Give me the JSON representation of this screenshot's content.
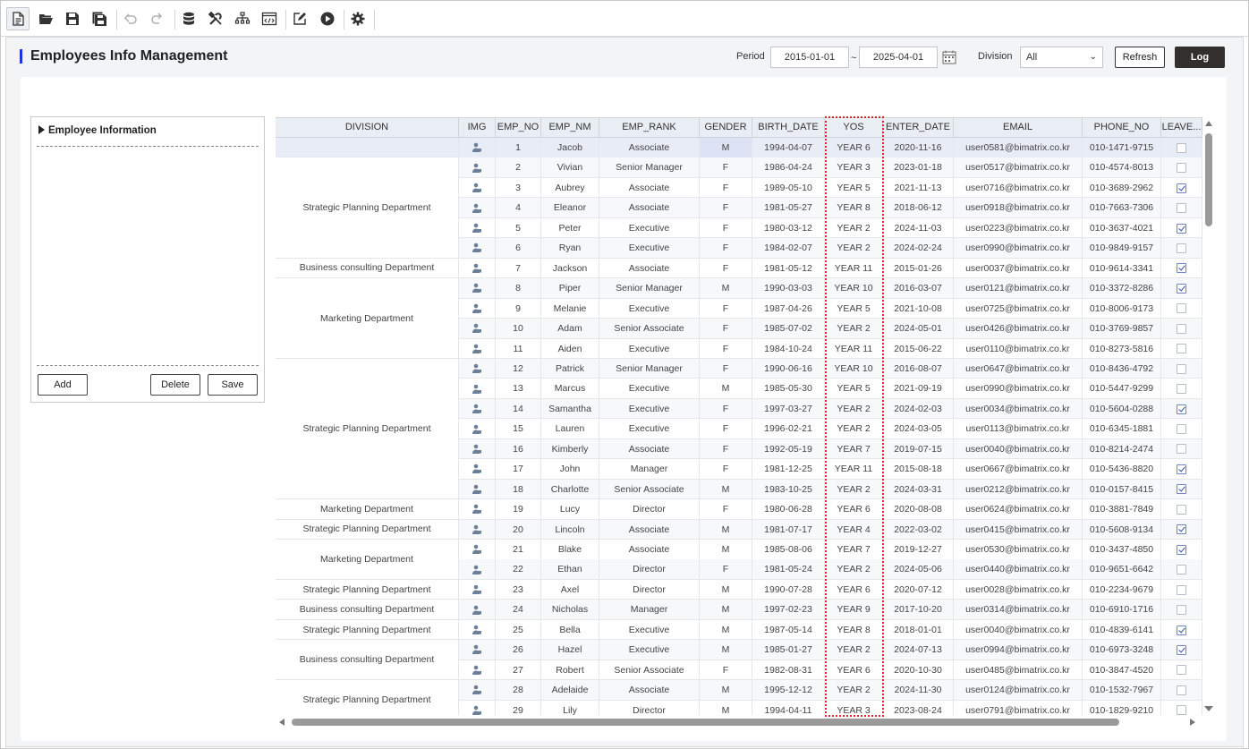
{
  "toolbar": {
    "icons": [
      "new-document-icon",
      "open-folder-icon",
      "save-icon",
      "save-all-icon",
      "undo-icon",
      "redo-icon",
      "database-icon",
      "tools-icon",
      "hierarchy-icon",
      "code-window-icon",
      "edit-icon",
      "run-icon",
      "settings-icon"
    ]
  },
  "header": {
    "title": "Employees Info Management",
    "period_label": "Period",
    "period_from": "2015-01-01",
    "period_sep": "~",
    "period_to": "2025-04-01",
    "division_label": "Division",
    "division_value": "All",
    "refresh_label": "Refresh",
    "log_label": "Log"
  },
  "left_panel": {
    "title": "Employee Information",
    "add_label": "Add",
    "delete_label": "Delete",
    "save_label": "Save"
  },
  "grid": {
    "columns": [
      "DIVISION",
      "IMG",
      "EMP_NO",
      "EMP_NM",
      "EMP_RANK",
      "GENDER",
      "BIRTH_DATE",
      "YOS",
      "ENTER_DATE",
      "EMAIL",
      "PHONE_NO",
      "LEAVE..."
    ],
    "division_groups": [
      {
        "label": "",
        "rows": 1
      },
      {
        "label": "Strategic Planning Department",
        "rows": 5
      },
      {
        "label": "Business consulting Department",
        "rows": 1
      },
      {
        "label": "Marketing Department",
        "rows": 4
      },
      {
        "label": "Strategic Planning Department",
        "rows": 7
      },
      {
        "label": "Marketing Department",
        "rows": 1
      },
      {
        "label": "Strategic Planning Department",
        "rows": 1
      },
      {
        "label": "Marketing Department",
        "rows": 2
      },
      {
        "label": "Strategic Planning Department",
        "rows": 1
      },
      {
        "label": "Business consulting Department",
        "rows": 1
      },
      {
        "label": "Strategic Planning Department",
        "rows": 1
      },
      {
        "label": "Business consulting Department",
        "rows": 2
      },
      {
        "label": "Strategic Planning Department",
        "rows": 2
      }
    ],
    "rows": [
      {
        "no": "1",
        "nm": "Jacob",
        "rank": "Associate",
        "g": "M",
        "bd": "1994-04-07",
        "yos": "YEAR 6",
        "ed": "2020-11-16",
        "email": "user0581@bimatrix.co.kr",
        "phone": "010-1471-9715",
        "leave": false
      },
      {
        "no": "2",
        "nm": "Vivian",
        "rank": "Senior Manager",
        "g": "F",
        "bd": "1986-04-24",
        "yos": "YEAR 3",
        "ed": "2023-01-18",
        "email": "user0517@bimatrix.co.kr",
        "phone": "010-4574-8013",
        "leave": false
      },
      {
        "no": "3",
        "nm": "Aubrey",
        "rank": "Associate",
        "g": "F",
        "bd": "1989-05-10",
        "yos": "YEAR 5",
        "ed": "2021-11-13",
        "email": "user0716@bimatrix.co.kr",
        "phone": "010-3689-2962",
        "leave": true
      },
      {
        "no": "4",
        "nm": "Eleanor",
        "rank": "Associate",
        "g": "F",
        "bd": "1981-05-27",
        "yos": "YEAR 8",
        "ed": "2018-06-12",
        "email": "user0918@bimatrix.co.kr",
        "phone": "010-7663-7306",
        "leave": false
      },
      {
        "no": "5",
        "nm": "Peter",
        "rank": "Executive",
        "g": "F",
        "bd": "1980-03-12",
        "yos": "YEAR 2",
        "ed": "2024-11-03",
        "email": "user0223@bimatrix.co.kr",
        "phone": "010-3637-4021",
        "leave": true
      },
      {
        "no": "6",
        "nm": "Ryan",
        "rank": "Executive",
        "g": "F",
        "bd": "1984-02-07",
        "yos": "YEAR 2",
        "ed": "2024-02-24",
        "email": "user0990@bimatrix.co.kr",
        "phone": "010-9849-9157",
        "leave": false
      },
      {
        "no": "7",
        "nm": "Jackson",
        "rank": "Associate",
        "g": "F",
        "bd": "1981-05-12",
        "yos": "YEAR 11",
        "ed": "2015-01-26",
        "email": "user0037@bimatrix.co.kr",
        "phone": "010-9614-3341",
        "leave": true
      },
      {
        "no": "8",
        "nm": "Piper",
        "rank": "Senior Manager",
        "g": "M",
        "bd": "1990-03-03",
        "yos": "YEAR 10",
        "ed": "2016-03-07",
        "email": "user0121@bimatrix.co.kr",
        "phone": "010-3372-8286",
        "leave": true
      },
      {
        "no": "9",
        "nm": "Melanie",
        "rank": "Executive",
        "g": "F",
        "bd": "1987-04-26",
        "yos": "YEAR 5",
        "ed": "2021-10-08",
        "email": "user0725@bimatrix.co.kr",
        "phone": "010-8006-9173",
        "leave": false
      },
      {
        "no": "10",
        "nm": "Adam",
        "rank": "Senior Associate",
        "g": "F",
        "bd": "1985-07-02",
        "yos": "YEAR 2",
        "ed": "2024-05-01",
        "email": "user0426@bimatrix.co.kr",
        "phone": "010-3769-9857",
        "leave": false
      },
      {
        "no": "11",
        "nm": "Aiden",
        "rank": "Executive",
        "g": "F",
        "bd": "1984-10-24",
        "yos": "YEAR 11",
        "ed": "2015-06-22",
        "email": "user0110@bimatrix.co.kr",
        "phone": "010-8273-5816",
        "leave": false
      },
      {
        "no": "12",
        "nm": "Patrick",
        "rank": "Senior Manager",
        "g": "F",
        "bd": "1990-06-16",
        "yos": "YEAR 10",
        "ed": "2016-08-07",
        "email": "user0647@bimatrix.co.kr",
        "phone": "010-8436-4792",
        "leave": false
      },
      {
        "no": "13",
        "nm": "Marcus",
        "rank": "Executive",
        "g": "M",
        "bd": "1985-05-30",
        "yos": "YEAR 5",
        "ed": "2021-09-19",
        "email": "user0990@bimatrix.co.kr",
        "phone": "010-5447-9299",
        "leave": false
      },
      {
        "no": "14",
        "nm": "Samantha",
        "rank": "Executive",
        "g": "F",
        "bd": "1997-03-27",
        "yos": "YEAR 2",
        "ed": "2024-02-03",
        "email": "user0034@bimatrix.co.kr",
        "phone": "010-5604-0288",
        "leave": true
      },
      {
        "no": "15",
        "nm": "Lauren",
        "rank": "Executive",
        "g": "F",
        "bd": "1996-02-21",
        "yos": "YEAR 2",
        "ed": "2024-03-05",
        "email": "user0113@bimatrix.co.kr",
        "phone": "010-6345-1881",
        "leave": false
      },
      {
        "no": "16",
        "nm": "Kimberly",
        "rank": "Associate",
        "g": "F",
        "bd": "1992-05-19",
        "yos": "YEAR 7",
        "ed": "2019-07-15",
        "email": "user0040@bimatrix.co.kr",
        "phone": "010-8214-2474",
        "leave": false
      },
      {
        "no": "17",
        "nm": "John",
        "rank": "Manager",
        "g": "F",
        "bd": "1981-12-25",
        "yos": "YEAR 11",
        "ed": "2015-08-18",
        "email": "user0667@bimatrix.co.kr",
        "phone": "010-5436-8820",
        "leave": true
      },
      {
        "no": "18",
        "nm": "Charlotte",
        "rank": "Senior Associate",
        "g": "M",
        "bd": "1983-10-25",
        "yos": "YEAR 2",
        "ed": "2024-03-31",
        "email": "user0212@bimatrix.co.kr",
        "phone": "010-0157-8415",
        "leave": true
      },
      {
        "no": "19",
        "nm": "Lucy",
        "rank": "Director",
        "g": "F",
        "bd": "1980-06-28",
        "yos": "YEAR 6",
        "ed": "2020-08-08",
        "email": "user0624@bimatrix.co.kr",
        "phone": "010-3881-7849",
        "leave": false
      },
      {
        "no": "20",
        "nm": "Lincoln",
        "rank": "Associate",
        "g": "M",
        "bd": "1981-07-17",
        "yos": "YEAR 4",
        "ed": "2022-03-02",
        "email": "user0415@bimatrix.co.kr",
        "phone": "010-5608-9134",
        "leave": true
      },
      {
        "no": "21",
        "nm": "Blake",
        "rank": "Associate",
        "g": "M",
        "bd": "1985-08-06",
        "yos": "YEAR 7",
        "ed": "2019-12-27",
        "email": "user0530@bimatrix.co.kr",
        "phone": "010-3437-4850",
        "leave": true
      },
      {
        "no": "22",
        "nm": "Ethan",
        "rank": "Director",
        "g": "F",
        "bd": "1981-05-24",
        "yos": "YEAR 2",
        "ed": "2024-05-06",
        "email": "user0440@bimatrix.co.kr",
        "phone": "010-9651-6642",
        "leave": false
      },
      {
        "no": "23",
        "nm": "Axel",
        "rank": "Director",
        "g": "M",
        "bd": "1990-07-28",
        "yos": "YEAR 6",
        "ed": "2020-07-12",
        "email": "user0028@bimatrix.co.kr",
        "phone": "010-2234-9679",
        "leave": false
      },
      {
        "no": "24",
        "nm": "Nicholas",
        "rank": "Manager",
        "g": "M",
        "bd": "1997-02-23",
        "yos": "YEAR 9",
        "ed": "2017-10-20",
        "email": "user0314@bimatrix.co.kr",
        "phone": "010-6910-1716",
        "leave": false
      },
      {
        "no": "25",
        "nm": "Bella",
        "rank": "Executive",
        "g": "M",
        "bd": "1987-05-14",
        "yos": "YEAR 8",
        "ed": "2018-01-01",
        "email": "user0040@bimatrix.co.kr",
        "phone": "010-4839-6141",
        "leave": true
      },
      {
        "no": "26",
        "nm": "Hazel",
        "rank": "Executive",
        "g": "M",
        "bd": "1985-01-27",
        "yos": "YEAR 2",
        "ed": "2024-07-13",
        "email": "user0994@bimatrix.co.kr",
        "phone": "010-6973-3248",
        "leave": true
      },
      {
        "no": "27",
        "nm": "Robert",
        "rank": "Senior Associate",
        "g": "F",
        "bd": "1982-08-31",
        "yos": "YEAR 6",
        "ed": "2020-10-30",
        "email": "user0485@bimatrix.co.kr",
        "phone": "010-3847-4520",
        "leave": false
      },
      {
        "no": "28",
        "nm": "Adelaide",
        "rank": "Associate",
        "g": "M",
        "bd": "1995-12-12",
        "yos": "YEAR 2",
        "ed": "2024-11-30",
        "email": "user0124@bimatrix.co.kr",
        "phone": "010-1532-7967",
        "leave": false
      },
      {
        "no": "29",
        "nm": "Lily",
        "rank": "Director",
        "g": "M",
        "bd": "1994-04-11",
        "yos": "YEAR 3",
        "ed": "2023-08-24",
        "email": "user0791@bimatrix.co.kr",
        "phone": "010-1829-9210",
        "leave": false
      }
    ]
  }
}
